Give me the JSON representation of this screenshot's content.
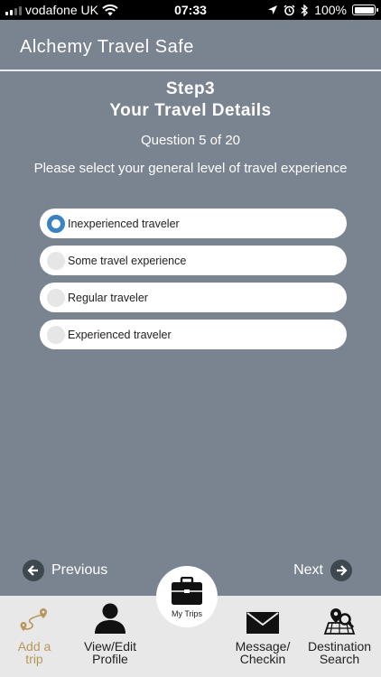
{
  "status_bar": {
    "carrier": "vodafone UK",
    "time": "07:33",
    "battery": "100%"
  },
  "header": {
    "title": "Alchemy Travel Safe"
  },
  "step": {
    "title": "Step3",
    "subtitle": "Your Travel Details",
    "question_count": "Question 5 of 20",
    "question": "Please select your general level of travel experience"
  },
  "options": [
    {
      "label": "Inexperienced traveler",
      "selected": true
    },
    {
      "label": "Some travel experience",
      "selected": false
    },
    {
      "label": "Regular traveler",
      "selected": false
    },
    {
      "label": "Experienced traveler",
      "selected": false
    }
  ],
  "navigation": {
    "previous_label": "Previous",
    "next_label": "Next"
  },
  "tab_bar": {
    "add_trip_line1": "Add a",
    "add_trip_line2": "trip",
    "profile_line1": "View/Edit",
    "profile_line2": "Profile",
    "my_trips": "My Trips",
    "message_line1": "Message/",
    "message_line2": "Checkin",
    "destination_line1": "Destination",
    "destination_line2": "Search"
  },
  "colors": {
    "background": "#7a8390",
    "selected_radio": "#3b82c4",
    "accent_gold": "#b8975a"
  }
}
